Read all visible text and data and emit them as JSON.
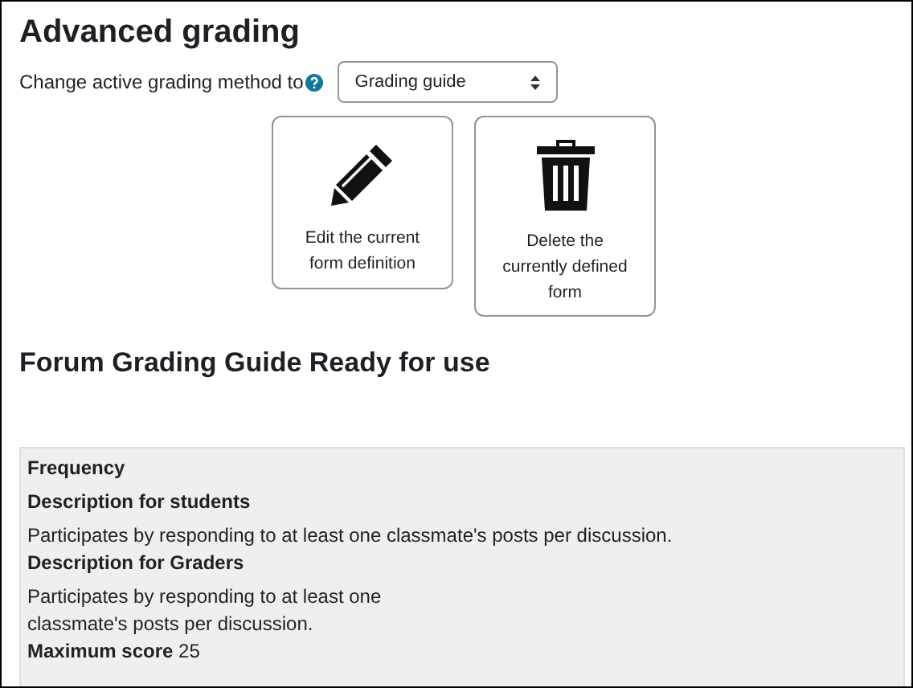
{
  "title": "Advanced grading",
  "method": {
    "label": "Change active grading method to",
    "value": "Grading guide"
  },
  "actions": [
    {
      "kind": "edit",
      "label": "Edit the current form definition"
    },
    {
      "kind": "delete",
      "label": "Delete the currently defined form"
    }
  ],
  "guide_heading": "Forum Grading Guide Ready for use",
  "criterion": {
    "name": "Frequency",
    "students_label": "Description for students",
    "students_text": [
      "Participates by responding to at least one classmate's posts per discussion."
    ],
    "graders_label": "Description for Graders",
    "graders_text": [
      "Participates by responding to at least one",
      "classmate's posts per discussion."
    ],
    "max_label": "Maximum score",
    "max_value": "25"
  }
}
